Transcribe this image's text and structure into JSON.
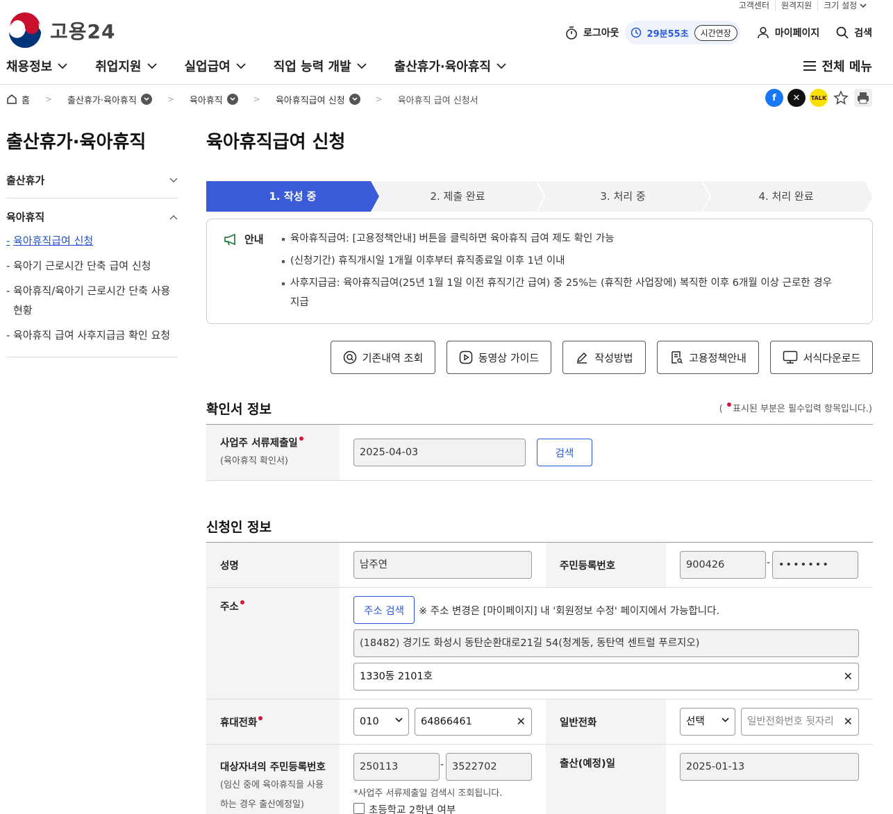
{
  "utility": {
    "items": [
      "고객센터",
      "원격지원",
      "크기 설정"
    ]
  },
  "logo": {
    "text": "고용24"
  },
  "header": {
    "logout": "로그아웃",
    "timer": "29분55초",
    "extend": "시간연장",
    "mypage": "마이페이지",
    "search": "검색"
  },
  "gnb": {
    "items": [
      "채용정보",
      "취업지원",
      "실업급여",
      "직업 능력 개발",
      "출산휴가·육아휴직"
    ],
    "allmenu": "전체 메뉴"
  },
  "breadcrumb": {
    "home": "홈",
    "items": [
      "출산휴가·육아휴직",
      "육아휴직",
      "육아휴직급여 신청"
    ],
    "current": "육아휴직 급여 신청서"
  },
  "colors": {
    "accent": "#3c5bd8",
    "required": "#d8143a",
    "facebook": "#1877f2",
    "kakao": "#f9e000"
  },
  "sidebar": {
    "title": "출산휴가·육아휴직",
    "sections": [
      {
        "label": "출산휴가",
        "expanded": false
      },
      {
        "label": "육아휴직",
        "expanded": true
      }
    ],
    "sub_items": [
      "육아휴직급여 신청",
      "육아기 근로시간 단축 급여 신청",
      "육아휴직/육아기 근로시간 단축 사용현황",
      "육아휴직 급여 사후지급금 확인 요청"
    ],
    "sub_item_2_line1": "육아휴직/육아기 근로시간 단축 사용",
    "sub_item_2_line2": "현황"
  },
  "page": {
    "title": "육아휴직급여 신청"
  },
  "steps": [
    "1. 작성 중",
    "2. 제출 완료",
    "3. 처리 중",
    "4. 처리 완료"
  ],
  "info": {
    "label": "안내",
    "lines": [
      "육아휴직급여: [고용정책안내] 버튼을 클릭하면 육아휴직 급여 제도 확인 가능",
      "(신청기간) 휴직개시일 1개월 이후부터 휴직종료일 이후 1년 이내",
      "사후지급금: 육아휴직급여(25년 1월 1일 이전 휴직기간 급여) 중 25%는 (휴직한 사업장에) 복직한 이후 6개월 이상 근로한 경우",
      "지급"
    ]
  },
  "actions": [
    "기존내역 조회",
    "동영상 가이드",
    "작성방법",
    "고용정책안내",
    "서식다운로드"
  ],
  "confirm": {
    "title": "확인서 정보",
    "required_note_pre": "(",
    "required_note_post": "표시된 부분은 필수입력 항목입니다.)",
    "submit_date_label": "사업주 서류제출일",
    "submit_date_sub": "(육아휴직 확인서)",
    "submit_date_value": "2025-04-03",
    "search_btn": "검색"
  },
  "applicant": {
    "title": "신청인 정보",
    "name_label": "성명",
    "name_value": "남주연",
    "rrn_label": "주민등록번호",
    "rrn_front": "900426",
    "rrn_back": "•••••••",
    "addr_label": "주소",
    "addr_search_btn": "주소 검색",
    "addr_note": "※ 주소 변경은 [마이페이지] 내 '회원정보 수정' 페이지에서 가능합니다.",
    "addr_main": "(18482) 경기도 화성시 동탄순환대로21길 54(청계동, 동탄역 센트럴 푸르지오)",
    "addr_detail": "1330동 2101호",
    "mobile_label": "휴대전화",
    "mobile_prefix": "010",
    "mobile_number": "64866461",
    "phone_label": "일반전화",
    "phone_prefix": "선택",
    "phone_placeholder": "일반전화번호 뒷자리",
    "child_rrn_label": "대상자녀의 주민등록번호",
    "child_rrn_sub1": "(임신 중에 육아휴직을 사용",
    "child_rrn_sub2": "하는 경우 출산예정일)",
    "child_rrn_front": "250113",
    "child_rrn_back": "3522702",
    "child_note": "*사업주 서류제출일 검색시 조회됩니다.",
    "grade_check": "초등학교 2학년 여부",
    "birth_label": "출산(예정)일",
    "birth_value": "2025-01-13"
  }
}
